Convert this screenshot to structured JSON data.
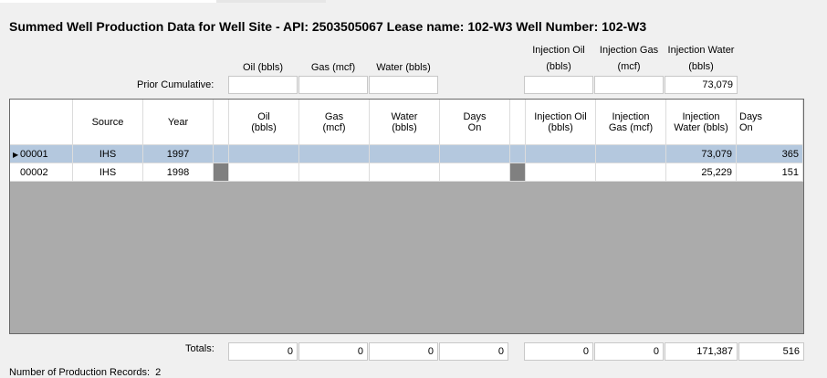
{
  "title": "Summed Well Production Data for Well Site - API: 2503505067  Lease name: 102-W3  Well Number: 102-W3",
  "top_headers": {
    "oil": "Oil (bbls)",
    "gas": "Gas (mcf)",
    "water": "Water (bbls)",
    "inj_oil_1": "Injection Oil",
    "inj_oil_2": "(bbls)",
    "inj_gas_1": "Injection Gas",
    "inj_gas_2": "(mcf)",
    "inj_water_1": "Injection Water",
    "inj_water_2": "(bbls)"
  },
  "prior": {
    "label": "Prior Cumulative:",
    "oil": "",
    "gas": "",
    "water": "",
    "inj_oil": "",
    "inj_gas": "",
    "inj_water": "73,079"
  },
  "grid": {
    "columns": {
      "source": "Source",
      "year": "Year",
      "oil_1": "Oil",
      "oil_2": "(bbls)",
      "gas_1": "Gas",
      "gas_2": "(mcf)",
      "water_1": "Water",
      "water_2": "(bbls)",
      "days_1": "Days",
      "days_2": "On",
      "inj_oil_1": "Injection Oil",
      "inj_oil_2": "(bbls)",
      "inj_gas_1": "Injection",
      "inj_gas_2": "Gas (mcf)",
      "inj_water_1": "Injection",
      "inj_water_2": "Water (bbls)",
      "inj_days_1": "Days",
      "inj_days_2": "On"
    },
    "rows": [
      {
        "id": "00001",
        "source": "IHS",
        "year": "1997",
        "oil": "",
        "gas": "",
        "water": "",
        "days": "",
        "inj_oil": "",
        "inj_gas": "",
        "inj_water": "73,079",
        "inj_days": "365"
      },
      {
        "id": "00002",
        "source": "IHS",
        "year": "1998",
        "oil": "",
        "gas": "",
        "water": "",
        "days": "",
        "inj_oil": "",
        "inj_gas": "",
        "inj_water": "25,229",
        "inj_days": "151"
      }
    ]
  },
  "totals": {
    "label": "Totals:",
    "oil": "0",
    "gas": "0",
    "water": "0",
    "days": "0",
    "inj_oil": "0",
    "inj_gas": "0",
    "inj_water": "171,387",
    "inj_days": "516"
  },
  "footer": {
    "records_label": "Number of Production Records:",
    "records_count": "2"
  },
  "colors": {
    "selected_row": "#b4c8de",
    "grid_background": "#ababab",
    "window_background": "#f0f0f0"
  }
}
